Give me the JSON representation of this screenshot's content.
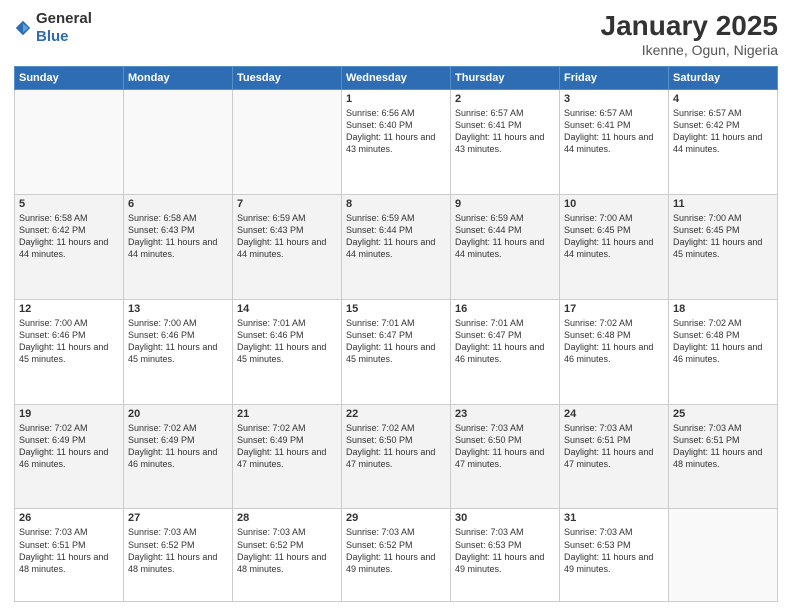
{
  "header": {
    "logo_general": "General",
    "logo_blue": "Blue",
    "title": "January 2025",
    "subtitle": "Ikenne, Ogun, Nigeria"
  },
  "days_of_week": [
    "Sunday",
    "Monday",
    "Tuesday",
    "Wednesday",
    "Thursday",
    "Friday",
    "Saturday"
  ],
  "weeks": [
    [
      {
        "num": "",
        "info": ""
      },
      {
        "num": "",
        "info": ""
      },
      {
        "num": "",
        "info": ""
      },
      {
        "num": "1",
        "info": "Sunrise: 6:56 AM\nSunset: 6:40 PM\nDaylight: 11 hours and 43 minutes."
      },
      {
        "num": "2",
        "info": "Sunrise: 6:57 AM\nSunset: 6:41 PM\nDaylight: 11 hours and 43 minutes."
      },
      {
        "num": "3",
        "info": "Sunrise: 6:57 AM\nSunset: 6:41 PM\nDaylight: 11 hours and 44 minutes."
      },
      {
        "num": "4",
        "info": "Sunrise: 6:57 AM\nSunset: 6:42 PM\nDaylight: 11 hours and 44 minutes."
      }
    ],
    [
      {
        "num": "5",
        "info": "Sunrise: 6:58 AM\nSunset: 6:42 PM\nDaylight: 11 hours and 44 minutes."
      },
      {
        "num": "6",
        "info": "Sunrise: 6:58 AM\nSunset: 6:43 PM\nDaylight: 11 hours and 44 minutes."
      },
      {
        "num": "7",
        "info": "Sunrise: 6:59 AM\nSunset: 6:43 PM\nDaylight: 11 hours and 44 minutes."
      },
      {
        "num": "8",
        "info": "Sunrise: 6:59 AM\nSunset: 6:44 PM\nDaylight: 11 hours and 44 minutes."
      },
      {
        "num": "9",
        "info": "Sunrise: 6:59 AM\nSunset: 6:44 PM\nDaylight: 11 hours and 44 minutes."
      },
      {
        "num": "10",
        "info": "Sunrise: 7:00 AM\nSunset: 6:45 PM\nDaylight: 11 hours and 44 minutes."
      },
      {
        "num": "11",
        "info": "Sunrise: 7:00 AM\nSunset: 6:45 PM\nDaylight: 11 hours and 45 minutes."
      }
    ],
    [
      {
        "num": "12",
        "info": "Sunrise: 7:00 AM\nSunset: 6:46 PM\nDaylight: 11 hours and 45 minutes."
      },
      {
        "num": "13",
        "info": "Sunrise: 7:00 AM\nSunset: 6:46 PM\nDaylight: 11 hours and 45 minutes."
      },
      {
        "num": "14",
        "info": "Sunrise: 7:01 AM\nSunset: 6:46 PM\nDaylight: 11 hours and 45 minutes."
      },
      {
        "num": "15",
        "info": "Sunrise: 7:01 AM\nSunset: 6:47 PM\nDaylight: 11 hours and 45 minutes."
      },
      {
        "num": "16",
        "info": "Sunrise: 7:01 AM\nSunset: 6:47 PM\nDaylight: 11 hours and 46 minutes."
      },
      {
        "num": "17",
        "info": "Sunrise: 7:02 AM\nSunset: 6:48 PM\nDaylight: 11 hours and 46 minutes."
      },
      {
        "num": "18",
        "info": "Sunrise: 7:02 AM\nSunset: 6:48 PM\nDaylight: 11 hours and 46 minutes."
      }
    ],
    [
      {
        "num": "19",
        "info": "Sunrise: 7:02 AM\nSunset: 6:49 PM\nDaylight: 11 hours and 46 minutes."
      },
      {
        "num": "20",
        "info": "Sunrise: 7:02 AM\nSunset: 6:49 PM\nDaylight: 11 hours and 46 minutes."
      },
      {
        "num": "21",
        "info": "Sunrise: 7:02 AM\nSunset: 6:49 PM\nDaylight: 11 hours and 47 minutes."
      },
      {
        "num": "22",
        "info": "Sunrise: 7:02 AM\nSunset: 6:50 PM\nDaylight: 11 hours and 47 minutes."
      },
      {
        "num": "23",
        "info": "Sunrise: 7:03 AM\nSunset: 6:50 PM\nDaylight: 11 hours and 47 minutes."
      },
      {
        "num": "24",
        "info": "Sunrise: 7:03 AM\nSunset: 6:51 PM\nDaylight: 11 hours and 47 minutes."
      },
      {
        "num": "25",
        "info": "Sunrise: 7:03 AM\nSunset: 6:51 PM\nDaylight: 11 hours and 48 minutes."
      }
    ],
    [
      {
        "num": "26",
        "info": "Sunrise: 7:03 AM\nSunset: 6:51 PM\nDaylight: 11 hours and 48 minutes."
      },
      {
        "num": "27",
        "info": "Sunrise: 7:03 AM\nSunset: 6:52 PM\nDaylight: 11 hours and 48 minutes."
      },
      {
        "num": "28",
        "info": "Sunrise: 7:03 AM\nSunset: 6:52 PM\nDaylight: 11 hours and 48 minutes."
      },
      {
        "num": "29",
        "info": "Sunrise: 7:03 AM\nSunset: 6:52 PM\nDaylight: 11 hours and 49 minutes."
      },
      {
        "num": "30",
        "info": "Sunrise: 7:03 AM\nSunset: 6:53 PM\nDaylight: 11 hours and 49 minutes."
      },
      {
        "num": "31",
        "info": "Sunrise: 7:03 AM\nSunset: 6:53 PM\nDaylight: 11 hours and 49 minutes."
      },
      {
        "num": "",
        "info": ""
      }
    ]
  ]
}
